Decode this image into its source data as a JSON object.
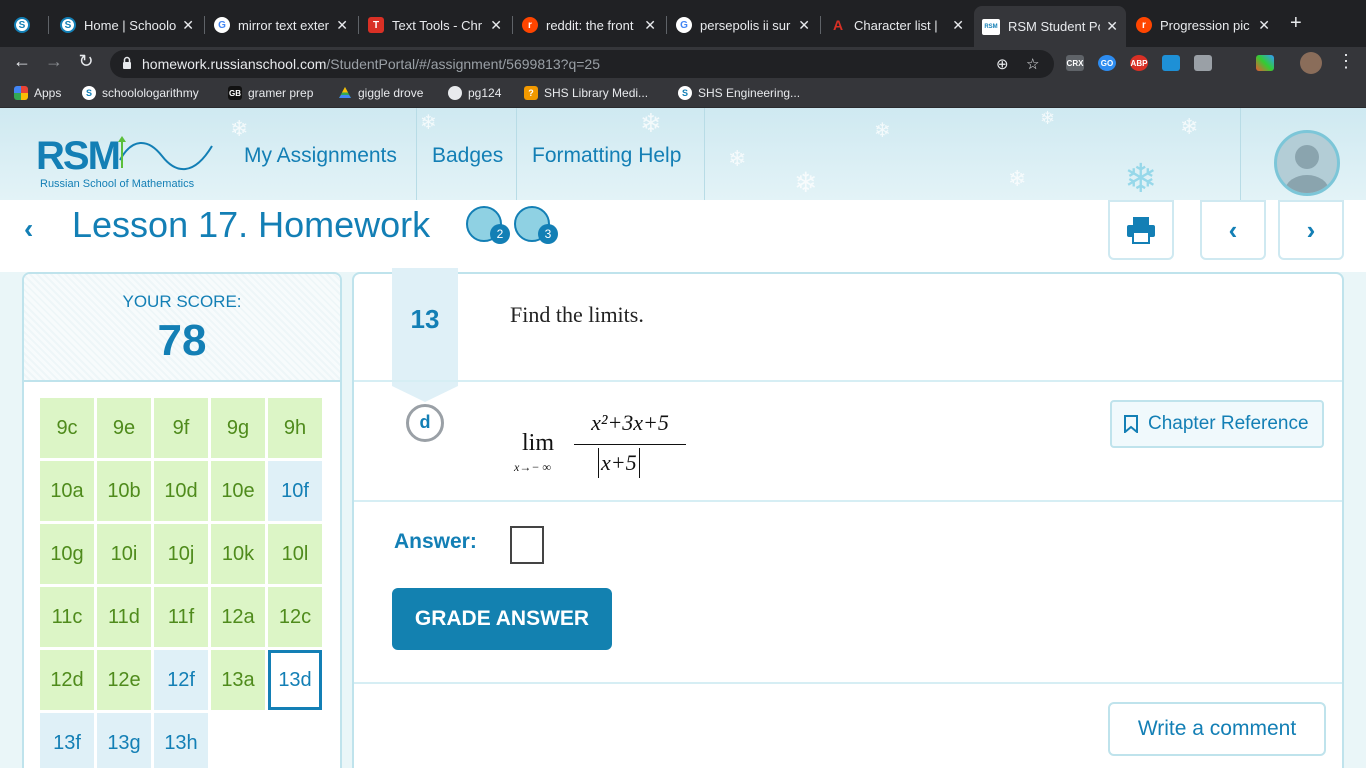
{
  "browser": {
    "tabs": [
      {
        "title": "",
        "favicon": "S",
        "color": "#137fb5"
      },
      {
        "title": "Home | Schoolo",
        "favicon": "S",
        "color": "#137fb5"
      },
      {
        "title": "mirror text exter",
        "favicon": "G",
        "color": "#4285f4"
      },
      {
        "title": "Text Tools - Chr",
        "favicon": "T",
        "color": "#d93025"
      },
      {
        "title": "reddit: the front",
        "favicon": "r",
        "color": "#ff4500"
      },
      {
        "title": "persepolis ii sur",
        "favicon": "G",
        "color": "#4285f4"
      },
      {
        "title": "Character list |",
        "favicon": "A",
        "color": "#d93025"
      },
      {
        "title": "RSM Student Po",
        "favicon": "RSM",
        "color": "#137fb5"
      },
      {
        "title": "Progression pic",
        "favicon": "r",
        "color": "#ff4500"
      }
    ],
    "new_tab": "+",
    "url_host": "homework.russianschool.com",
    "url_path": "/StudentPortal/#/assignment/5699813?q=25",
    "bookmarks": [
      {
        "label": "Apps",
        "icon": "apps-grid"
      },
      {
        "label": "schoolologarithmy",
        "icon": "S"
      },
      {
        "label": "gramer prep",
        "icon": "GB"
      },
      {
        "label": "giggle drove",
        "icon": "drive"
      },
      {
        "label": "pg124",
        "icon": "globe"
      },
      {
        "label": "SHS Library Medi...",
        "icon": "book"
      },
      {
        "label": "SHS Engineering...",
        "icon": "S"
      }
    ],
    "extensions": [
      "CRX",
      "GO",
      "ABP",
      "",
      "",
      ""
    ]
  },
  "site": {
    "logo_text": "RSM",
    "logo_subtitle": "Russian School of Mathematics",
    "nav": [
      "My Assignments",
      "Badges",
      "Formatting Help"
    ]
  },
  "lesson": {
    "title": "Lesson 17. Homework",
    "badge1_count": "2",
    "badge2_count": "3"
  },
  "score": {
    "label": "YOUR SCORE:",
    "value": "78"
  },
  "problems": [
    {
      "label": "9c",
      "status": "done"
    },
    {
      "label": "9e",
      "status": "done"
    },
    {
      "label": "9f",
      "status": "done"
    },
    {
      "label": "9g",
      "status": "done"
    },
    {
      "label": "9h",
      "status": "done"
    },
    {
      "label": "10a",
      "status": "done"
    },
    {
      "label": "10b",
      "status": "done"
    },
    {
      "label": "10d",
      "status": "done"
    },
    {
      "label": "10e",
      "status": "done"
    },
    {
      "label": "10f",
      "status": "todo"
    },
    {
      "label": "10g",
      "status": "done"
    },
    {
      "label": "10i",
      "status": "done"
    },
    {
      "label": "10j",
      "status": "done"
    },
    {
      "label": "10k",
      "status": "done"
    },
    {
      "label": "10l",
      "status": "done"
    },
    {
      "label": "11c",
      "status": "done"
    },
    {
      "label": "11d",
      "status": "done"
    },
    {
      "label": "11f",
      "status": "done"
    },
    {
      "label": "12a",
      "status": "done"
    },
    {
      "label": "12c",
      "status": "done"
    },
    {
      "label": "12d",
      "status": "done"
    },
    {
      "label": "12e",
      "status": "done"
    },
    {
      "label": "12f",
      "status": "todo"
    },
    {
      "label": "13a",
      "status": "done"
    },
    {
      "label": "13d",
      "status": "current"
    },
    {
      "label": "13f",
      "status": "todo"
    },
    {
      "label": "13g",
      "status": "todo"
    },
    {
      "label": "13h",
      "status": "todo"
    }
  ],
  "question": {
    "number": "13",
    "prompt": "Find the limits.",
    "part": "d",
    "math": {
      "lim": "lim",
      "subscript": "x→− ∞",
      "numerator": "x²+3x+5",
      "denominator": "x+5"
    },
    "chapter_reference": "Chapter Reference",
    "answer_label": "Answer:",
    "grade_button": "GRADE ANSWER",
    "comment_button": "Write a comment"
  },
  "colors": {
    "brand": "#137fb5",
    "done_bg": "#dcf5c6",
    "done_text": "#4f8b1c",
    "todo_bg": "#dff0f7"
  }
}
